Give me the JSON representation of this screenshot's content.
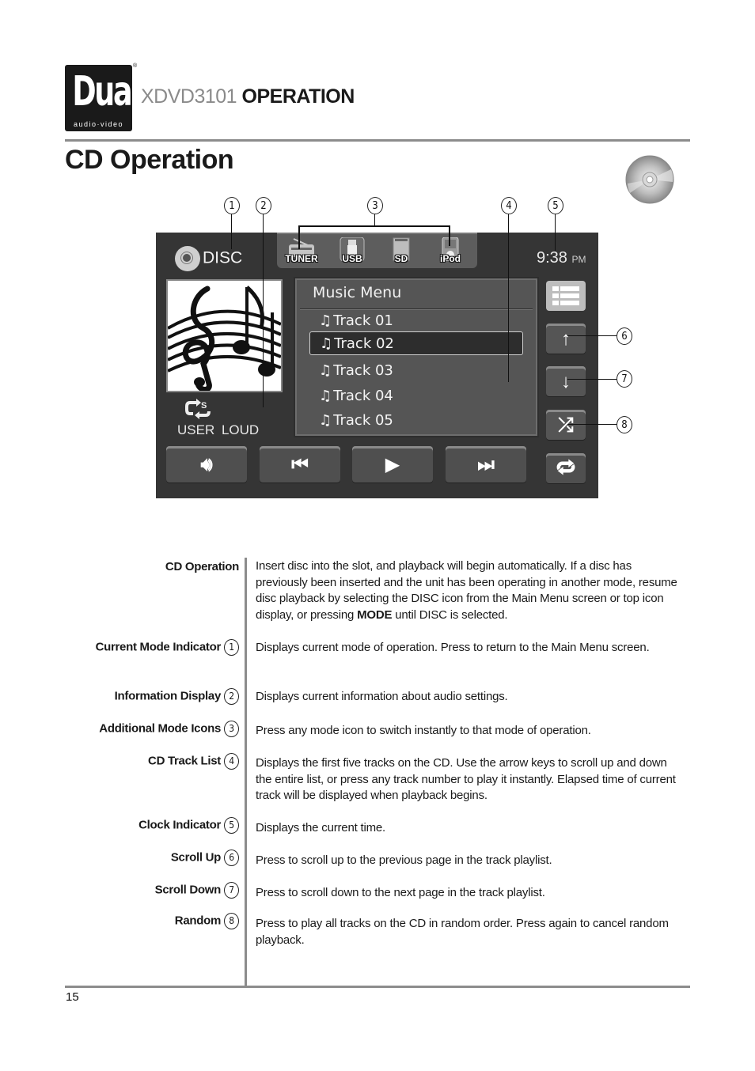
{
  "header": {
    "logo": {
      "brand": "Dual",
      "tagline": "audio·video",
      "registered": "®"
    },
    "model": "XDVD3101",
    "section": "OPERATION"
  },
  "page_title": "CD Operation",
  "page_number": "15",
  "screen": {
    "mode_indicator": {
      "icon": "disc-icon",
      "label": "DISC"
    },
    "mode_icons": [
      {
        "icon": "radio-icon",
        "label": "TUNER"
      },
      {
        "icon": "usb-drive-icon",
        "label": "USB"
      },
      {
        "icon": "sd-card-icon",
        "label": "SD"
      },
      {
        "icon": "ipod-icon",
        "label": "iPod"
      }
    ],
    "clock": {
      "time": "9:38",
      "ampm": "PM"
    },
    "album_art": "music-notes-image",
    "info": {
      "icon": "user-eq-icon",
      "text": "USER  LOUD"
    },
    "music_menu": {
      "title": "Music Menu",
      "tracks": [
        "Track 01",
        "Track 02",
        "Track 03",
        "Track 04",
        "Track 05"
      ],
      "selected_index": 1,
      "note_glyph": "♫"
    },
    "side_buttons": [
      {
        "name": "list-view",
        "glyph": "☰"
      },
      {
        "name": "scroll-up",
        "glyph": "↑"
      },
      {
        "name": "scroll-down",
        "glyph": "↓"
      },
      {
        "name": "random",
        "glyph": "⤮"
      }
    ],
    "controls": [
      {
        "name": "volume",
        "glyph": "🔊︎"
      },
      {
        "name": "previous-track",
        "glyph": "⏮︎"
      },
      {
        "name": "play",
        "glyph": "▶︎"
      },
      {
        "name": "next-track",
        "glyph": "⏭︎"
      }
    ],
    "repeat": {
      "glyph": "🔁︎"
    }
  },
  "callouts": [
    "1",
    "2",
    "3",
    "4",
    "5",
    "6",
    "7",
    "8"
  ],
  "descriptions": [
    {
      "term": "CD Operation",
      "callout": "",
      "text_before": "Insert disc into the slot, and playback will begin automatically. If a disc has previously been inserted and the unit has been operating in another mode, resume disc playback by selecting the DISC icon from the Main Menu screen or top icon display, or pressing ",
      "bold": "MODE",
      "text_after": " until DISC is selected."
    },
    {
      "term": "Current Mode Indicator",
      "callout": "1",
      "text": "Displays current mode of operation. Press to return to the Main Menu screen."
    },
    {
      "term": "Information Display",
      "callout": "2",
      "text": "Displays current information about audio settings."
    },
    {
      "term": "Additional Mode Icons",
      "callout": "3",
      "text": "Press any mode icon to switch instantly to that mode of operation."
    },
    {
      "term": "CD Track List",
      "callout": "4",
      "text": "Displays the first five tracks on the CD. Use the arrow keys to scroll up and down the entire list, or press any track number to play it instantly. Elapsed time of current track will be displayed when playback begins."
    },
    {
      "term": "Clock Indicator",
      "callout": "5",
      "text": "Displays the current time."
    },
    {
      "term": "Scroll Up",
      "callout": "6",
      "text": "Press to scroll up to the previous page in the track playlist."
    },
    {
      "term": "Scroll Down",
      "callout": "7",
      "text": "Press to scroll down to the next page in the track playlist."
    },
    {
      "term": "Random",
      "callout": "8",
      "text": "Press to play all tracks on the CD in random order. Press again to cancel random playback."
    }
  ]
}
